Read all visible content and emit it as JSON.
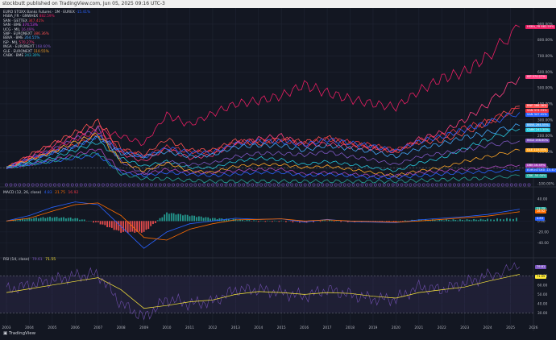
{
  "header": {
    "text": "stockbutt published on TradingView.com, Jun 05, 2025 09:16 UTC-3"
  },
  "legend": [
    {
      "symbol": "EURO STOXX Banks Futures · 1M · EUREX",
      "value": "-15.41%",
      "color": "#2962ff"
    },
    {
      "symbol": "HSBA_FR · GNWHEX",
      "value": "882.59%",
      "color": "#e91e63"
    },
    {
      "symbol": "SAN · GETTEX",
      "value": "347.41%",
      "color": "#f23645"
    },
    {
      "symbol": "SAN · BME",
      "value": "374.53%",
      "color": "#e040fb"
    },
    {
      "symbol": "UCG · MIL",
      "value": "16.49%",
      "color": "#ab47bc"
    },
    {
      "symbol": "SNP · EURONEXT",
      "value": "386.36%",
      "color": "#ff5252"
    },
    {
      "symbol": "BBVA · BME",
      "value": "264.55%",
      "color": "#42a5f5"
    },
    {
      "symbol": "ISP · MIL",
      "value": "570.27%",
      "color": "#ff4081"
    },
    {
      "symbol": "INGA · EURONEXT",
      "value": "168.60%",
      "color": "#7e57c2"
    },
    {
      "symbol": "GLE · EURONEXT",
      "value": "110.55%",
      "color": "#ffa726"
    },
    {
      "symbol": "CABK · BME",
      "value": "243.30%",
      "color": "#26c6da"
    }
  ],
  "macd_label": {
    "name": "MACD (12, 26, close)",
    "v1": "4.83",
    "v2": "21.75",
    "v3": "16.92"
  },
  "rsi_label": {
    "name": "RSI (14, close)",
    "v1": "79.61",
    "v2": "71.55"
  },
  "right_tags": [
    {
      "text": "HSBA_FR 882.59%",
      "color": "#e91e63"
    },
    {
      "text": "ISP 570.27%",
      "color": "#ff4081"
    },
    {
      "text": "BNP 386.36%",
      "color": "#ff5252"
    },
    {
      "text": "SAN 374.53%",
      "color": "#f23645"
    },
    {
      "text": "SAN 347.41%",
      "color": "#2962ff"
    },
    {
      "text": "BBVA 264.55%",
      "color": "#42a5f5"
    },
    {
      "text": "CABK 243.30%",
      "color": "#26c6da"
    },
    {
      "text": "INGA 168.60%",
      "color": "#7e57c2"
    },
    {
      "text": "GLE 110.55%",
      "color": "#ffa726"
    },
    {
      "text": "DBK 16.49%",
      "color": "#ab47bc"
    },
    {
      "text": "EUROSTOXX -15.41%",
      "color": "#2962ff"
    },
    {
      "text": "CBK -50.00%",
      "color": "#26a69a"
    }
  ],
  "rsi_tags": [
    {
      "text": "79.61",
      "color": "#7e57c2"
    },
    {
      "text": "71.55",
      "color": "#ffeb3b"
    }
  ],
  "footer": "TradingView",
  "chart_data": {
    "type": "line",
    "x_ticks": [
      "2003",
      "2004",
      "2005",
      "2006",
      "2007",
      "2008",
      "2009",
      "2010",
      "2011",
      "2012",
      "2013",
      "2014",
      "2015",
      "2016",
      "2017",
      "2018",
      "2019",
      "2020",
      "2021",
      "2022",
      "2023",
      "2024",
      "2025",
      "2026"
    ],
    "y_ticks": [
      "900.00%",
      "800.00%",
      "700.00%",
      "600.00%",
      "500.00%",
      "400.00%",
      "300.00%",
      "200.00%",
      "100.00%",
      "0.00%",
      "-100.00%"
    ],
    "ylim": [
      -100,
      950
    ],
    "x": [
      2003,
      2004,
      2005,
      2006,
      2007,
      2008,
      2009,
      2010,
      2011,
      2012,
      2013,
      2014,
      2015,
      2016,
      2017,
      2018,
      2019,
      2020,
      2021,
      2022,
      2023,
      2024,
      2025.4
    ],
    "series": [
      {
        "name": "HSBA_FR",
        "color": "#e91e63",
        "values": [
          0,
          60,
          110,
          180,
          230,
          200,
          150,
          330,
          270,
          340,
          400,
          420,
          450,
          520,
          470,
          430,
          400,
          380,
          480,
          560,
          600,
          700,
          882
        ]
      },
      {
        "name": "ISP",
        "color": "#ff4081",
        "values": [
          0,
          70,
          140,
          200,
          260,
          90,
          40,
          120,
          60,
          80,
          150,
          180,
          200,
          140,
          150,
          130,
          120,
          100,
          180,
          220,
          300,
          400,
          570
        ]
      },
      {
        "name": "BNP",
        "color": "#ff5252",
        "values": [
          0,
          80,
          150,
          220,
          290,
          120,
          80,
          180,
          110,
          110,
          170,
          150,
          180,
          160,
          190,
          150,
          130,
          100,
          160,
          170,
          220,
          280,
          386
        ]
      },
      {
        "name": "SAN",
        "color": "#f23645",
        "values": [
          0,
          50,
          100,
          140,
          210,
          110,
          70,
          130,
          100,
          100,
          160,
          170,
          170,
          150,
          180,
          160,
          140,
          110,
          170,
          200,
          250,
          290,
          374
        ]
      },
      {
        "name": "SAN",
        "color": "#2962ff",
        "values": [
          0,
          50,
          95,
          135,
          200,
          105,
          65,
          125,
          95,
          95,
          150,
          165,
          165,
          145,
          175,
          155,
          135,
          105,
          165,
          195,
          240,
          280,
          347
        ]
      },
      {
        "name": "BBVA",
        "color": "#42a5f5",
        "values": [
          0,
          40,
          90,
          130,
          190,
          90,
          70,
          100,
          70,
          80,
          130,
          140,
          140,
          110,
          140,
          120,
          100,
          70,
          120,
          150,
          190,
          220,
          264
        ]
      },
      {
        "name": "CABK",
        "color": "#26c6da",
        "values": [
          0,
          30,
          60,
          110,
          160,
          60,
          10,
          40,
          0,
          0,
          40,
          60,
          50,
          20,
          40,
          20,
          0,
          -20,
          30,
          60,
          120,
          180,
          243
        ]
      },
      {
        "name": "INGA",
        "color": "#7e57c2",
        "values": [
          0,
          60,
          110,
          180,
          240,
          40,
          -40,
          40,
          20,
          30,
          70,
          90,
          90,
          80,
          100,
          70,
          50,
          20,
          70,
          90,
          110,
          140,
          168
        ]
      },
      {
        "name": "GLE",
        "color": "#ffa726",
        "values": [
          0,
          50,
          100,
          160,
          210,
          40,
          -20,
          30,
          -20,
          -30,
          10,
          20,
          20,
          0,
          10,
          -10,
          -30,
          -50,
          -20,
          0,
          40,
          70,
          110
        ]
      },
      {
        "name": "DBK",
        "color": "#ab47bc",
        "values": [
          0,
          20,
          50,
          80,
          120,
          -20,
          -40,
          -10,
          -30,
          -30,
          -20,
          -10,
          -10,
          -40,
          -30,
          -40,
          -50,
          -50,
          -30,
          -20,
          -10,
          0,
          16
        ]
      },
      {
        "name": "EUROSTOXX",
        "color": "#2962ff",
        "values": [
          0,
          20,
          40,
          60,
          80,
          -30,
          -50,
          -30,
          -40,
          -50,
          -40,
          -30,
          -30,
          -50,
          -40,
          -50,
          -60,
          -60,
          -50,
          -40,
          -30,
          -25,
          -15
        ]
      },
      {
        "name": "CBK",
        "color": "#26a69a",
        "values": [
          0,
          20,
          40,
          70,
          90,
          -40,
          -70,
          -70,
          -80,
          -85,
          -85,
          -85,
          -85,
          -85,
          -85,
          -85,
          -85,
          -85,
          -80,
          -75,
          -70,
          -65,
          -50
        ]
      }
    ],
    "macd": {
      "y_ticks": [
        "40.00",
        "20.00",
        "0.00",
        "-20.00",
        "-40.00"
      ],
      "ylim": [
        -60,
        55
      ],
      "macd": [
        0,
        10,
        25,
        35,
        30,
        -10,
        -50,
        -20,
        -5,
        0,
        5,
        3,
        4,
        -2,
        3,
        -1,
        -2,
        -3,
        2,
        5,
        8,
        12,
        21.75
      ],
      "signal": [
        0,
        5,
        18,
        30,
        33,
        10,
        -30,
        -35,
        -15,
        -5,
        2,
        3,
        4,
        0,
        2,
        0,
        -1,
        -2,
        0,
        3,
        6,
        9,
        16.92
      ],
      "hist": [
        0,
        5,
        7,
        5,
        -3,
        -20,
        -20,
        15,
        10,
        5,
        3,
        0,
        0,
        -2,
        1,
        -1,
        -1,
        -1,
        2,
        2,
        2,
        3,
        4.83
      ],
      "tags": [
        "21.75",
        "16.92",
        "4.83"
      ]
    },
    "rsi": {
      "y_ticks": [
        "70.00",
        "60.00",
        "50.00",
        "40.00",
        "30.00"
      ],
      "ylim": [
        20,
        85
      ],
      "rsi": [
        55,
        60,
        65,
        70,
        72,
        40,
        25,
        45,
        40,
        42,
        55,
        55,
        52,
        48,
        55,
        50,
        45,
        45,
        58,
        55,
        62,
        70,
        79.61
      ],
      "ma": [
        52,
        56,
        60,
        64,
        68,
        55,
        35,
        38,
        42,
        44,
        50,
        53,
        52,
        50,
        52,
        51,
        48,
        46,
        52,
        55,
        58,
        64,
        71.55
      ]
    }
  }
}
